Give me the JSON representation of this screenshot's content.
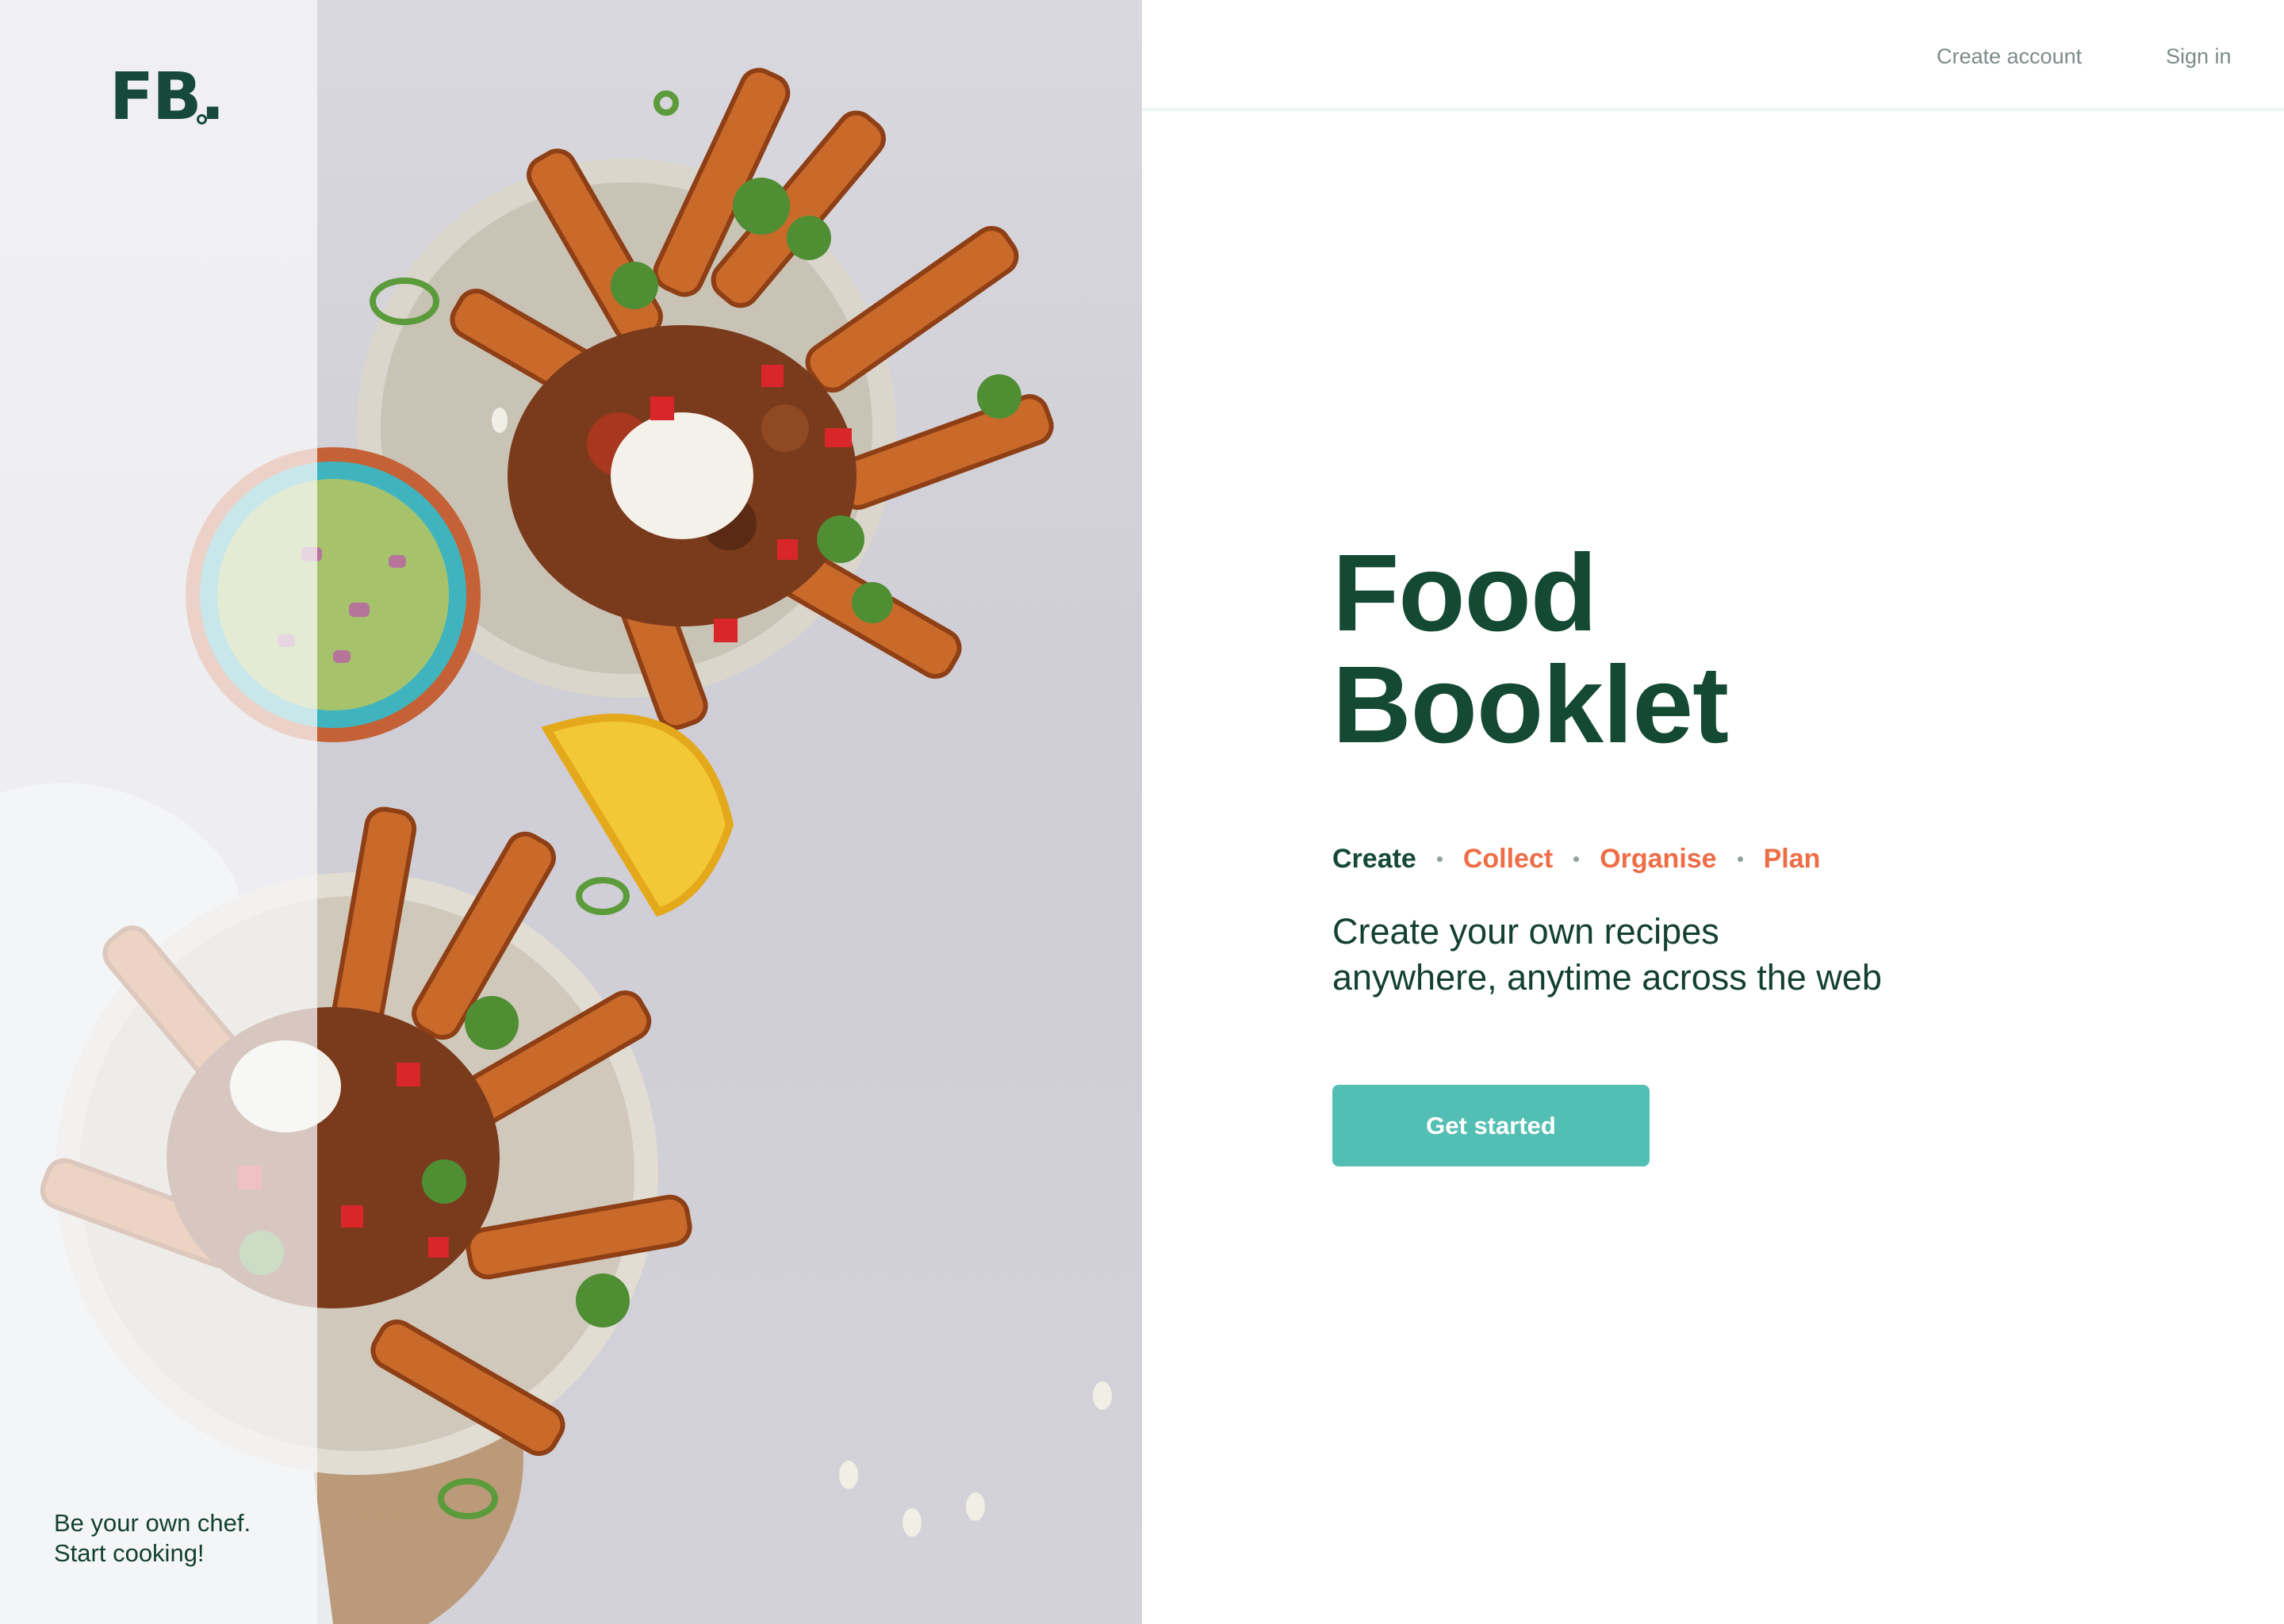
{
  "brand": {
    "logo": "FB.",
    "tagline_line1": "Be your own chef.",
    "tagline_line2": "Start cooking!"
  },
  "nav": {
    "create_account": "Create account",
    "sign_in": "Sign in"
  },
  "hero": {
    "title_line1": "Food",
    "title_line2": "Booklet",
    "pillars": [
      "Create",
      "Collect",
      "Organise",
      "Plan"
    ],
    "subtitle_line1": "Create your own recipes",
    "subtitle_line2": "anywhere, anytime across the web",
    "cta_label": "Get started"
  },
  "colors": {
    "brand_dark_green": "#144934",
    "accent_orange": "#ee6d47",
    "button_teal": "#53beb3",
    "nav_gray": "#7b8b89"
  },
  "image": {
    "description_icon": "food-photo"
  }
}
